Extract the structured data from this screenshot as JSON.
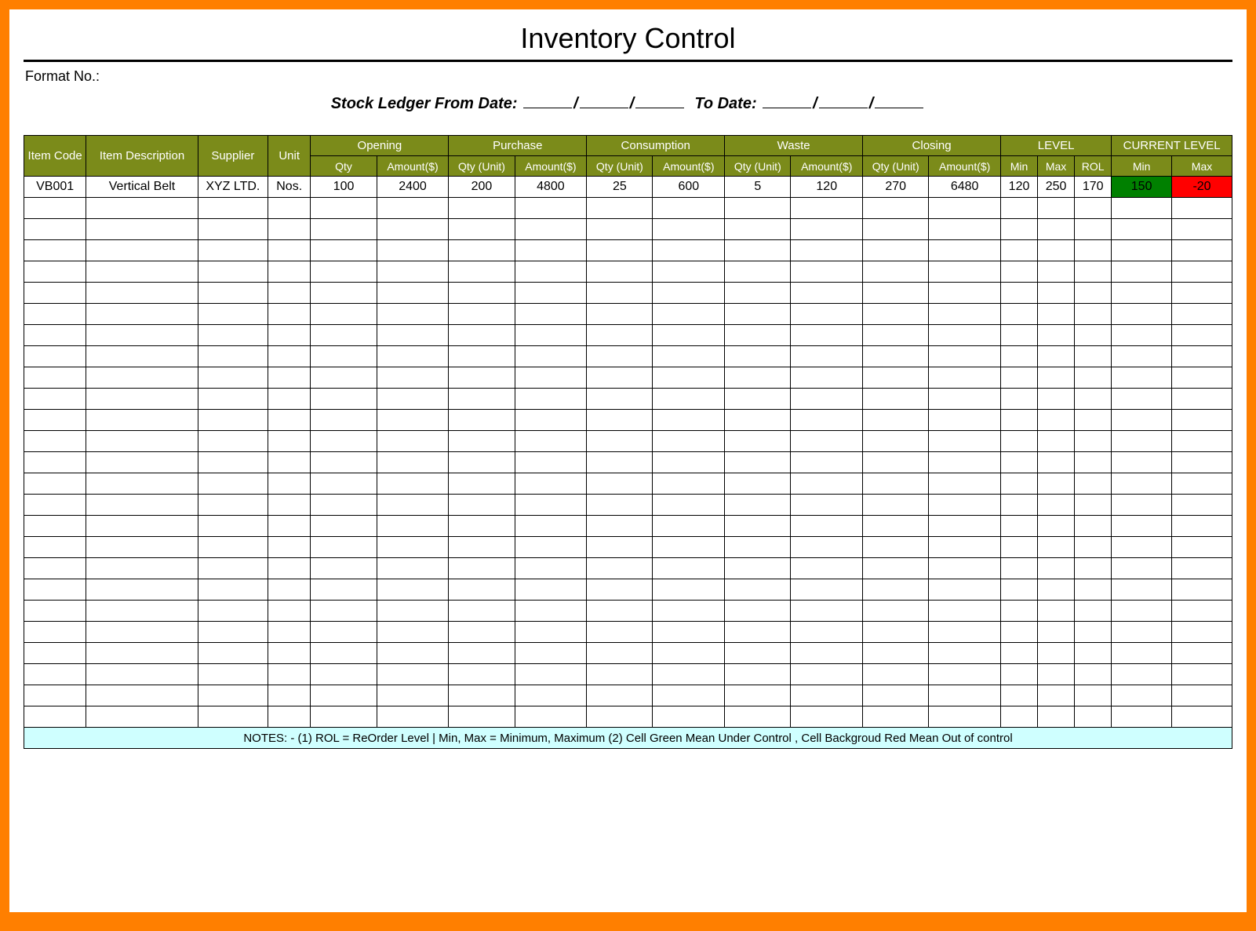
{
  "title": "Inventory Control",
  "format_label": "Format No.:",
  "ledger": {
    "prefix": "Stock Ledger From Date:",
    "to_label": "To Date:"
  },
  "headers": {
    "item_code": "Item Code",
    "item_desc": "Item Description",
    "supplier": "Supplier",
    "unit": "Unit",
    "groups": {
      "opening": "Opening",
      "purchase": "Purchase",
      "consumption": "Consumption",
      "waste": "Waste",
      "closing": "Closing",
      "level": "LEVEL",
      "current_level": "CURRENT LEVEL"
    },
    "sub": {
      "qty": "Qty",
      "amount": "Amount($)",
      "qty_unit": "Qty (Unit)",
      "min": "Min",
      "max": "Max",
      "rol": "ROL"
    }
  },
  "rows": [
    {
      "item_code": "VB001",
      "item_desc": "Vertical Belt",
      "supplier": "XYZ LTD.",
      "unit": "Nos.",
      "opening_qty": "100",
      "opening_amt": "2400",
      "purchase_qty": "200",
      "purchase_amt": "4800",
      "consumption_qty": "25",
      "consumption_amt": "600",
      "waste_qty": "5",
      "waste_amt": "120",
      "closing_qty": "270",
      "closing_amt": "6480",
      "level_min": "120",
      "level_max": "250",
      "level_rol": "170",
      "current_min": "150",
      "current_max": "-20",
      "current_min_status": "green",
      "current_max_status": "red"
    }
  ],
  "empty_row_count": 25,
  "notes": "NOTES: - (1) ROL = ReOrder Level | Min, Max = Minimum, Maximum     (2) Cell Green Mean Under Control , Cell Backgroud Red Mean Out of control"
}
